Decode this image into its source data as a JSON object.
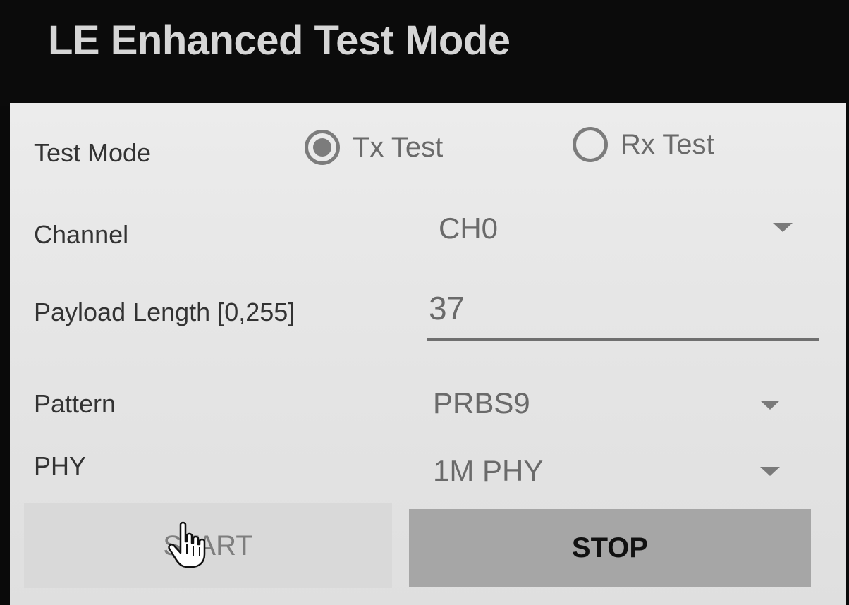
{
  "app": {
    "title": "LE Enhanced Test Mode"
  },
  "test_mode": {
    "label": "Test Mode",
    "options": [
      {
        "label": "Tx Test",
        "selected": true
      },
      {
        "label": "Rx Test",
        "selected": false
      }
    ]
  },
  "channel": {
    "label": "Channel",
    "value": "CH0",
    "icon": "dropdown-arrow"
  },
  "payload_length": {
    "label": "Payload Length [0,255]",
    "value": "37"
  },
  "pattern": {
    "label": "Pattern",
    "value": "PRBS9",
    "icon": "dropdown-arrow"
  },
  "phy": {
    "label": "PHY",
    "value": "1M PHY",
    "icon": "dropdown-arrow"
  },
  "buttons": {
    "start_label": "START",
    "stop_label": "STOP"
  },
  "cursor": {
    "icon": "hand-pointer"
  },
  "colors": {
    "app_bar": "#0b0b0b",
    "title_text": "#d6d6d6",
    "screen_bg": "#e8e8e8",
    "start_button": "#d9d9d9",
    "stop_button": "#a6a6a6"
  }
}
